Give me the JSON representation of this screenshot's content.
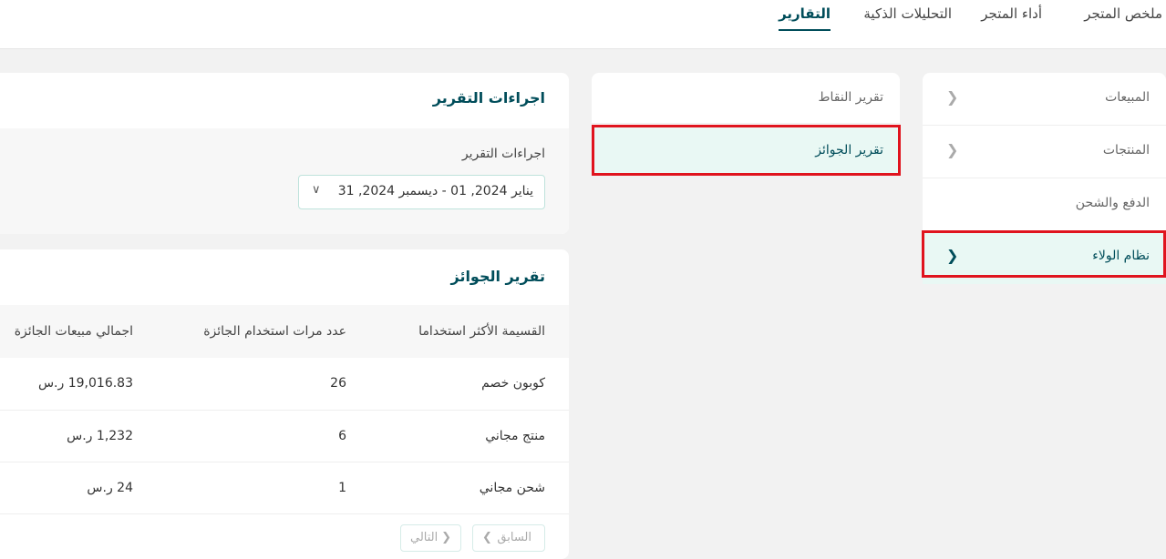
{
  "top_tabs": [
    {
      "label": "ملخص المتجر",
      "active": false
    },
    {
      "label": "أداء المتجر",
      "active": false
    },
    {
      "label": "التحليلات الذكية",
      "active": false
    },
    {
      "label": "التقارير",
      "active": true
    }
  ],
  "categories": [
    {
      "label": "المبيعات",
      "has_chevron": true,
      "selected": false
    },
    {
      "label": "المنتجات",
      "has_chevron": true,
      "selected": false
    },
    {
      "label": "الدفع والشحن",
      "has_chevron": false,
      "selected": false
    },
    {
      "label": "نظام الولاء",
      "has_chevron": true,
      "selected": true
    }
  ],
  "sub_reports": [
    {
      "label": "تقرير النقاط",
      "selected": false
    },
    {
      "label": "تقرير الجوائز",
      "selected": true
    }
  ],
  "report_actions": {
    "title": "اجراءات التقرير",
    "field_label": "اجراءات التقرير",
    "date_range": "يناير 2024, 01 - ديسمبر 2024, 31"
  },
  "rewards_report": {
    "title": "تقرير الجوائز",
    "columns": [
      "القسيمة الأكثر استخداما",
      "عدد مرات استخدام الجائزة",
      "اجمالي مبيعات الجائزة"
    ],
    "rows": [
      [
        "كوبون خصم",
        "26",
        "19,016.83 ر.س"
      ],
      [
        "منتج مجاني",
        "6",
        "1,232 ر.س"
      ],
      [
        "شحن مجاني",
        "1",
        "24 ر.س"
      ]
    ],
    "pagination": {
      "prev": "السابق",
      "next": "التالي"
    }
  },
  "colors": {
    "accent": "#004d5a",
    "selected_bg": "#e9f8f4",
    "highlight": "#e0141e"
  }
}
